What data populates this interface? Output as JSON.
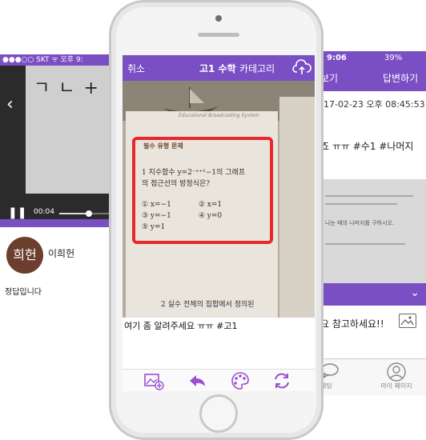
{
  "left_screen": {
    "status_bar": "●●●○○ SKT  ᯤ     오후 9:",
    "handwriting": "ㄱ ㄴ + ㅣ ㄷ",
    "video_time": "00:04",
    "progress": 0.6,
    "author_avatar_text": "희헌",
    "author_name": "이희헌",
    "answer": "정답입니다"
  },
  "right_screen": {
    "status_time": "9:06",
    "status_battery": "39%",
    "nav_left": "보기",
    "nav_right": "답변하기",
    "date": "17-02-23 오후 08:45:53",
    "tags": "죠 ㅠㅠ #수1 #나머지",
    "paper_text": "나눈 때의 나머지를 구하시오.",
    "caption": "요 참고하세요!!",
    "tab_chat_label": "채팅",
    "tab_my_label": "마이 페이지"
  },
  "app": {
    "cancel": "취소",
    "subject": "고1 수학",
    "category": "카테고리",
    "photo": {
      "ebs": "Educational Broadcasting System",
      "box_title": "필수 유형 문제",
      "problem_line1": "1  지수함수 y=2⁻ˣ⁺¹−1의 그래프",
      "problem_line2": "의 점근선의 방정식은?",
      "choices": [
        "① x=−1",
        "② x=1",
        "③ y=−1",
        "④ y=0",
        "⑤ y=1"
      ],
      "second_problem": "2  실수 전체의 집합에서 정의된"
    },
    "caption": "여기 좀 알려주세요 ㅠㅠ #고1"
  },
  "colors": {
    "accent": "#7b4fc4",
    "highlight": "#e8282d"
  }
}
